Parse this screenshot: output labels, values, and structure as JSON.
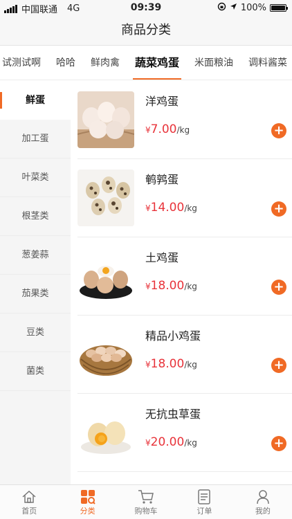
{
  "status_bar": {
    "carrier": "中国联通",
    "network": "4G",
    "time": "09:39",
    "battery": "100%",
    "battery_level": 1.0
  },
  "header": {
    "title": "商品分类"
  },
  "top_tabs": [
    {
      "label": "试测试啊"
    },
    {
      "label": "哈哈"
    },
    {
      "label": "鲜肉禽"
    },
    {
      "label": "蔬菜鸡蛋",
      "active": true
    },
    {
      "label": "米面粮油"
    },
    {
      "label": "调料酱菜"
    },
    {
      "label": "新"
    }
  ],
  "sidebar": {
    "items": [
      {
        "label": "鲜蛋",
        "active": true
      },
      {
        "label": "加工蛋"
      },
      {
        "label": "叶菜类"
      },
      {
        "label": "根茎类"
      },
      {
        "label": "葱姜蒜"
      },
      {
        "label": "茄果类"
      },
      {
        "label": "豆类"
      },
      {
        "label": "菌类"
      }
    ]
  },
  "products": [
    {
      "name": "洋鸡蛋",
      "currency": "¥",
      "price": "7.00",
      "unit": "/kg",
      "image": "white-eggs-basket"
    },
    {
      "name": "鹌鹑蛋",
      "currency": "¥",
      "price": "14.00",
      "unit": "/kg",
      "image": "quail-eggs"
    },
    {
      "name": "土鸡蛋",
      "currency": "¥",
      "price": "18.00",
      "unit": "/kg",
      "image": "brown-eggs-bowl"
    },
    {
      "name": "精品小鸡蛋",
      "currency": "¥",
      "price": "18.00",
      "unit": "/kg",
      "image": "small-eggs-basket"
    },
    {
      "name": "无抗虫草蛋",
      "currency": "¥",
      "price": "20.00",
      "unit": "/kg",
      "image": "cordyceps-eggs"
    }
  ],
  "tabbar": [
    {
      "label": "首页",
      "icon": "home-icon"
    },
    {
      "label": "分类",
      "icon": "category-icon",
      "active": true
    },
    {
      "label": "购物车",
      "icon": "cart-icon"
    },
    {
      "label": "订单",
      "icon": "order-icon"
    },
    {
      "label": "我的",
      "icon": "profile-icon"
    }
  ],
  "colors": {
    "accent": "#f06a25",
    "price": "#e8333a"
  }
}
